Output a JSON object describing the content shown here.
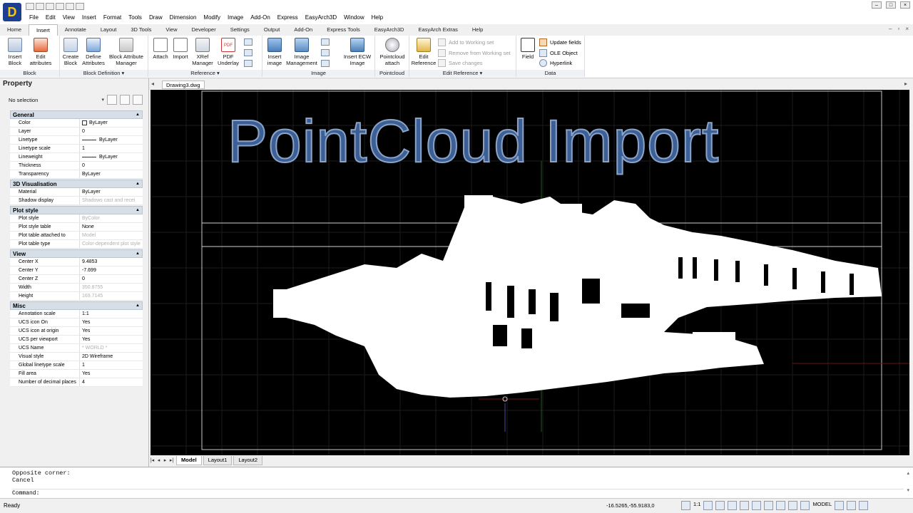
{
  "menu": [
    "File",
    "Edit",
    "View",
    "Insert",
    "Format",
    "Tools",
    "Draw",
    "Dimension",
    "Modify",
    "Image",
    "Add-On",
    "Express",
    "EasyArch3D",
    "Window",
    "Help"
  ],
  "tabs": [
    "Home",
    "Insert",
    "Annotate",
    "Layout",
    "3D Tools",
    "View",
    "Developer",
    "Settings",
    "Output",
    "Add-On",
    "Express Tools",
    "EasyArch3D",
    "EasyArch Extras",
    "Help"
  ],
  "active_tab": "Insert",
  "ribbon": {
    "block": {
      "label": "Block",
      "insert": "Insert\nBlock",
      "edit": "Edit\nattributes"
    },
    "blockdef": {
      "label": "Block Definition",
      "create": "Create\nBlock",
      "define": "Define\nAttributes",
      "bam": "Block Attribute\nManager"
    },
    "reference": {
      "label": "Reference",
      "attach": "Attach",
      "import": "Import",
      "xref": "XRef\nManager",
      "pdf": "PDF\nUnderlay"
    },
    "image": {
      "label": "Image",
      "insert": "Insert\nimage",
      "mgmt": "Image\nManagement",
      "ecw": "Insert ECW\nImage"
    },
    "pointcloud": {
      "label": "Pointcloud",
      "attach": "Pointcloud\nattach"
    },
    "editref": {
      "label": "Edit Reference",
      "edit": "Edit\nReference",
      "add": "Add to Working set",
      "remove": "Remove from Working set",
      "save": "Save changes"
    },
    "data": {
      "label": "Data",
      "field": "Field",
      "update": "Update fields",
      "ole": "OLE Object",
      "hyper": "Hyperlink"
    }
  },
  "panel": {
    "title": "Property",
    "selection": "No selection",
    "sections": [
      {
        "name": "General",
        "rows": [
          {
            "k": "Color",
            "v": "ByLayer",
            "kind": "swatch"
          },
          {
            "k": "Layer",
            "v": "0"
          },
          {
            "k": "Linetype",
            "v": "ByLayer",
            "kind": "line"
          },
          {
            "k": "Linetype scale",
            "v": "1"
          },
          {
            "k": "Lineweight",
            "v": "ByLayer",
            "kind": "line"
          },
          {
            "k": "Thickness",
            "v": "0"
          },
          {
            "k": "Transparency",
            "v": "ByLayer"
          }
        ]
      },
      {
        "name": "3D Visualisation",
        "rows": [
          {
            "k": "Material",
            "v": "ByLayer"
          },
          {
            "k": "Shadow display",
            "v": "Shadows cast and recei",
            "dim": true
          }
        ]
      },
      {
        "name": "Plot style",
        "rows": [
          {
            "k": "Plot style",
            "v": "ByColor",
            "dim": true
          },
          {
            "k": "Plot style table",
            "v": "None"
          },
          {
            "k": "Plot table attached to",
            "v": "Model",
            "dim": true
          },
          {
            "k": "Plot table type",
            "v": "Color-dependent plot style",
            "dim": true
          }
        ]
      },
      {
        "name": "View",
        "rows": [
          {
            "k": "Center X",
            "v": "9.4853"
          },
          {
            "k": "Center Y",
            "v": "-7.699"
          },
          {
            "k": "Center Z",
            "v": "0"
          },
          {
            "k": "Width",
            "v": "350.8755",
            "dim": true
          },
          {
            "k": "Height",
            "v": "169.7145",
            "dim": true
          }
        ]
      },
      {
        "name": "Misc",
        "rows": [
          {
            "k": "Annotation scale",
            "v": "1:1"
          },
          {
            "k": "UCS icon On",
            "v": "Yes"
          },
          {
            "k": "UCS icon at origin",
            "v": "Yes"
          },
          {
            "k": "UCS per viewport",
            "v": "Yes"
          },
          {
            "k": "UCS Name",
            "v": "* WORLD *",
            "dim": true
          },
          {
            "k": "Visual style",
            "v": "2D Wireframe"
          },
          {
            "k": "Global linetype scale",
            "v": "1"
          },
          {
            "k": "Fill area",
            "v": "Yes"
          },
          {
            "k": "Number of decimal places",
            "v": "4"
          }
        ]
      }
    ]
  },
  "doc_tab": "Drawing3.dwg",
  "canvas_title": "PointCloud Import",
  "layout_tabs": [
    "Model",
    "Layout1",
    "Layout2"
  ],
  "command": {
    "history": "Opposite corner:\nCancel",
    "prompt": "Command:"
  },
  "status": {
    "text": "Ready",
    "coords": "-16.5265,-55.9183,0",
    "scale": "1:1",
    "model": "MODEL"
  }
}
